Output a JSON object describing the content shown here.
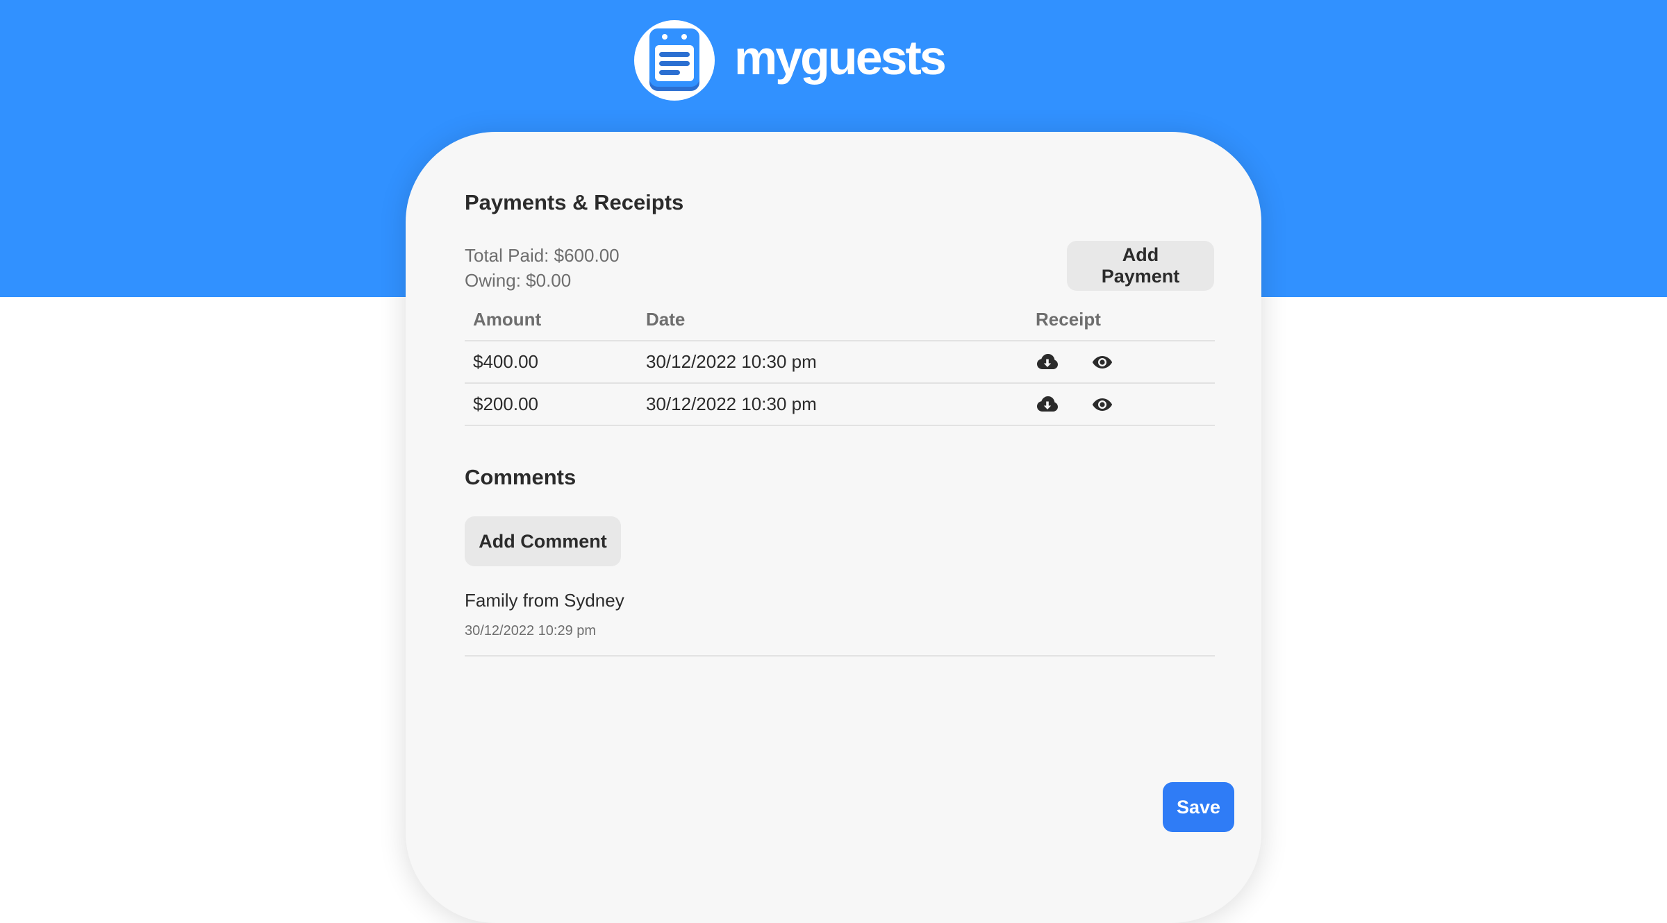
{
  "brand": {
    "name": "myguests",
    "logo_icon": "notepad-icon"
  },
  "payments": {
    "title": "Payments & Receipts",
    "total_paid": "Total Paid: $600.00",
    "owing": "Owing: $0.00",
    "add_button": "Add Payment",
    "columns": [
      "Amount",
      "Date",
      "Receipt"
    ],
    "rows": [
      {
        "amount": "$400.00",
        "date": "30/12/2022 10:30 pm",
        "actions": [
          "download-icon",
          "eye-icon"
        ]
      },
      {
        "amount": "$200.00",
        "date": "30/12/2022 10:30 pm",
        "actions": [
          "download-icon",
          "eye-icon"
        ]
      }
    ]
  },
  "comments": {
    "title": "Comments",
    "add_button": "Add Comment",
    "items": [
      {
        "text": "Family from Sydney",
        "timestamp": "30/12/2022 10:29 pm"
      }
    ]
  },
  "save_button": "Save",
  "colors": {
    "header_blue": "#3191ff",
    "save_blue": "#2f7cf6",
    "card_bg": "#f7f7f7",
    "button_gray": "#e8e8e8"
  }
}
